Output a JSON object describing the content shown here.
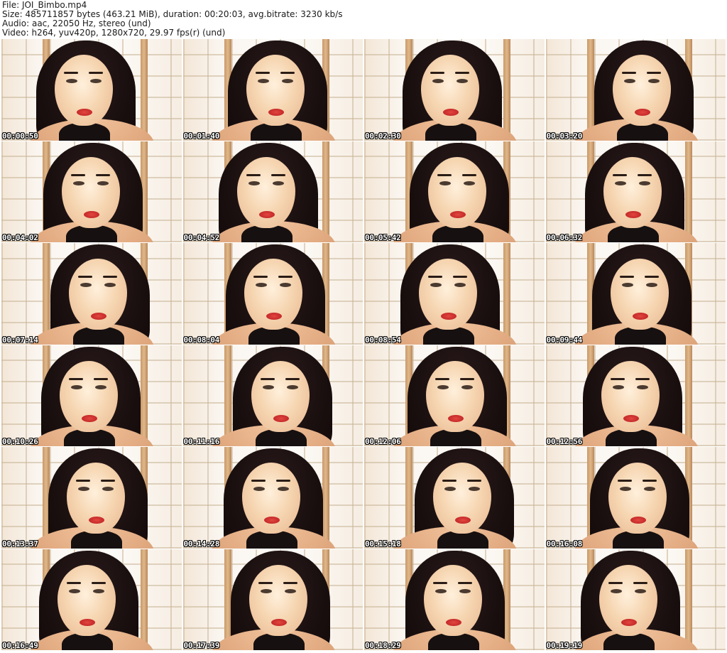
{
  "header": {
    "file_line": "File: JOI_Bimbo.mp4",
    "size_line": "Size: 485711857 bytes (463.21 MiB), duration: 00:20:03, avg.bitrate: 3230 kb/s",
    "audio_line": "Audio: aac, 22050 Hz, stereo (und)",
    "video_line": "Video: h264, yuv420p, 1280x720, 29.97 fps(r) (und)"
  },
  "thumbnails": [
    {
      "timestamp": "00:00:50"
    },
    {
      "timestamp": "00:01:40"
    },
    {
      "timestamp": "00:02:30"
    },
    {
      "timestamp": "00:03:20"
    },
    {
      "timestamp": "00:04:02"
    },
    {
      "timestamp": "00:04:52"
    },
    {
      "timestamp": "00:05:42"
    },
    {
      "timestamp": "00:06:32"
    },
    {
      "timestamp": "00:07:14"
    },
    {
      "timestamp": "00:08:04"
    },
    {
      "timestamp": "00:08:54"
    },
    {
      "timestamp": "00:09:44"
    },
    {
      "timestamp": "00:10:26"
    },
    {
      "timestamp": "00:11:16"
    },
    {
      "timestamp": "00:12:06"
    },
    {
      "timestamp": "00:12:56"
    },
    {
      "timestamp": "00:13:37"
    },
    {
      "timestamp": "00:14:28"
    },
    {
      "timestamp": "00:15:18"
    },
    {
      "timestamp": "00:16:08"
    },
    {
      "timestamp": "00:16:49"
    },
    {
      "timestamp": "00:17:39"
    },
    {
      "timestamp": "00:18:29"
    },
    {
      "timestamp": "00:19:19"
    }
  ],
  "colors": {
    "background": "#ffffff",
    "timestamp_text": "#ffffff",
    "timestamp_outline": "#000000",
    "lips": "#d43a35",
    "hair": "#1b1010"
  }
}
